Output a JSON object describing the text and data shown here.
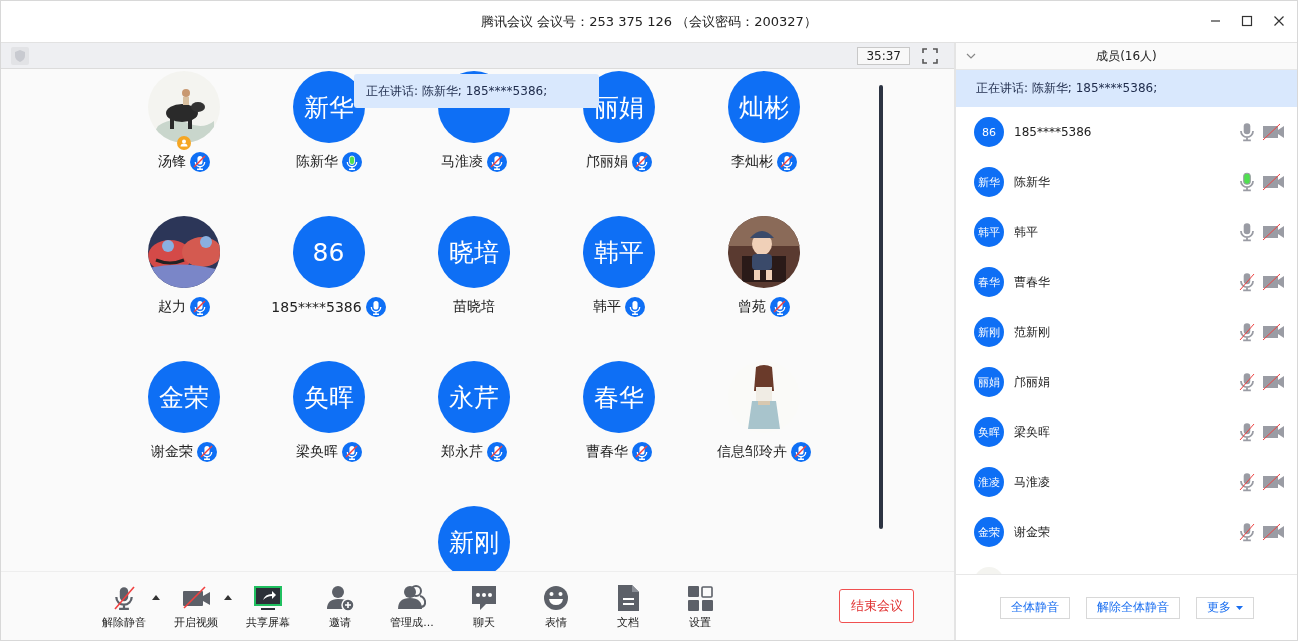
{
  "window": {
    "title": "腾讯会议 会议号：253 375 126 （会议密码：200327）"
  },
  "video_toolbar": {
    "timer": "35:37"
  },
  "speaking_tooltip": "正在讲话: 陈新华; 185****5386;",
  "participants": [
    {
      "name": "汤锋",
      "avatar": {
        "kind": "picture"
      },
      "mic": {
        "muted": true,
        "speaking": false
      },
      "host": true
    },
    {
      "name": "陈新华",
      "avatar": {
        "kind": "initials",
        "text": "新华"
      },
      "mic": {
        "muted": false,
        "speaking": true
      },
      "host": false
    },
    {
      "name": "马淮凌",
      "avatar": {
        "kind": "initials"
      },
      "mic": {
        "muted": true,
        "speaking": false
      },
      "host": false
    },
    {
      "name": "邝丽娟",
      "avatar": {
        "kind": "initials",
        "text": "丽娟"
      },
      "mic": {
        "muted": true,
        "speaking": false
      },
      "host": false
    },
    {
      "name": "李灿彬",
      "avatar": {
        "kind": "initials",
        "text": "灿彬"
      },
      "mic": {
        "muted": true,
        "speaking": false
      },
      "host": false
    },
    {
      "name": "赵力",
      "avatar": {
        "kind": "picture"
      },
      "mic": {
        "muted": true,
        "speaking": false
      },
      "host": false
    },
    {
      "name": "185****5386",
      "avatar": {
        "kind": "initials",
        "text": "86"
      },
      "mic": {
        "muted": false,
        "speaking": false
      },
      "host": false
    },
    {
      "name": "苗晓培",
      "avatar": {
        "kind": "initials",
        "text": "晓培"
      },
      "host": false
    },
    {
      "name": "韩平",
      "avatar": {
        "kind": "initials",
        "text": "韩平"
      },
      "mic": {
        "muted": false,
        "speaking": false
      },
      "host": false
    },
    {
      "name": "曾苑",
      "avatar": {
        "kind": "picture"
      },
      "mic": {
        "muted": true,
        "speaking": false
      },
      "host": false
    },
    {
      "name": "谢金荣",
      "avatar": {
        "kind": "initials",
        "text": "金荣"
      },
      "mic": {
        "muted": true,
        "speaking": false
      },
      "host": false
    },
    {
      "name": "梁奂晖",
      "avatar": {
        "kind": "initials",
        "text": "奂晖"
      },
      "mic": {
        "muted": true,
        "speaking": false
      },
      "host": false
    },
    {
      "name": "郑永芹",
      "avatar": {
        "kind": "initials",
        "text": "永芹"
      },
      "mic": {
        "muted": true,
        "speaking": false
      },
      "host": false
    },
    {
      "name": "曹春华",
      "avatar": {
        "kind": "initials",
        "text": "春华"
      },
      "mic": {
        "muted": true,
        "speaking": false
      },
      "host": false
    },
    {
      "name": "信息邹玲卉",
      "avatar": {
        "kind": "picture"
      },
      "mic": {
        "muted": true,
        "speaking": false
      },
      "host": false
    },
    {
      "avatar": {
        "kind": "initials",
        "text": "新刚"
      },
      "host": false
    }
  ],
  "bottom_toolbar": [
    {
      "label": "解除静音",
      "kind": "mic",
      "caret": true
    },
    {
      "label": "开启视频",
      "kind": "video",
      "caret": true
    },
    {
      "label": "共享屏幕",
      "kind": "share",
      "caret": false
    },
    {
      "label": "邀请",
      "kind": "invite",
      "caret": false
    },
    {
      "label": "管理成...",
      "kind": "members",
      "caret": false
    },
    {
      "label": "聊天",
      "kind": "chat",
      "caret": false
    },
    {
      "label": "表情",
      "kind": "emoji",
      "caret": false
    },
    {
      "label": "文档",
      "kind": "doc",
      "caret": false
    },
    {
      "label": "设置",
      "kind": "settings",
      "caret": false
    }
  ],
  "end_button": "结束会议",
  "members_panel": {
    "title": "成员(16人)",
    "speaking": "正在讲话: 陈新华; 185****5386;",
    "members": [
      {
        "name": "185****5386",
        "avatar": {
          "kind": "initials",
          "text": "86"
        },
        "mic_muted": false,
        "speaking": false,
        "camera_off": true
      },
      {
        "name": "陈新华",
        "avatar": {
          "kind": "initials",
          "text": "新华"
        },
        "mic_muted": false,
        "speaking": true,
        "camera_off": true
      },
      {
        "name": "韩平",
        "avatar": {
          "kind": "initials",
          "text": "韩平"
        },
        "mic_muted": false,
        "speaking": false,
        "camera_off": true
      },
      {
        "name": "曹春华",
        "avatar": {
          "kind": "initials",
          "text": "春华"
        },
        "mic_muted": true,
        "speaking": false,
        "camera_off": true
      },
      {
        "name": "范新刚",
        "avatar": {
          "kind": "initials",
          "text": "新刚"
        },
        "mic_muted": true,
        "speaking": false,
        "camera_off": true
      },
      {
        "name": "邝丽娟",
        "avatar": {
          "kind": "initials",
          "text": "丽娟"
        },
        "mic_muted": true,
        "speaking": false,
        "camera_off": true
      },
      {
        "name": "梁奂晖",
        "avatar": {
          "kind": "initials",
          "text": "奂晖"
        },
        "mic_muted": true,
        "speaking": false,
        "camera_off": true
      },
      {
        "name": "马淮凌",
        "avatar": {
          "kind": "initials",
          "text": "淮凌"
        },
        "mic_muted": true,
        "speaking": false,
        "camera_off": true
      },
      {
        "name": "谢金荣",
        "avatar": {
          "kind": "initials",
          "text": "金荣"
        },
        "mic_muted": true,
        "speaking": false,
        "camera_off": true
      },
      {
        "avatar": {
          "kind": "picture"
        }
      }
    ],
    "buttons": [
      {
        "label": "全体静音",
        "caret": false
      },
      {
        "label": "解除全体静音",
        "caret": false
      },
      {
        "label": "更多",
        "caret": true
      }
    ]
  }
}
